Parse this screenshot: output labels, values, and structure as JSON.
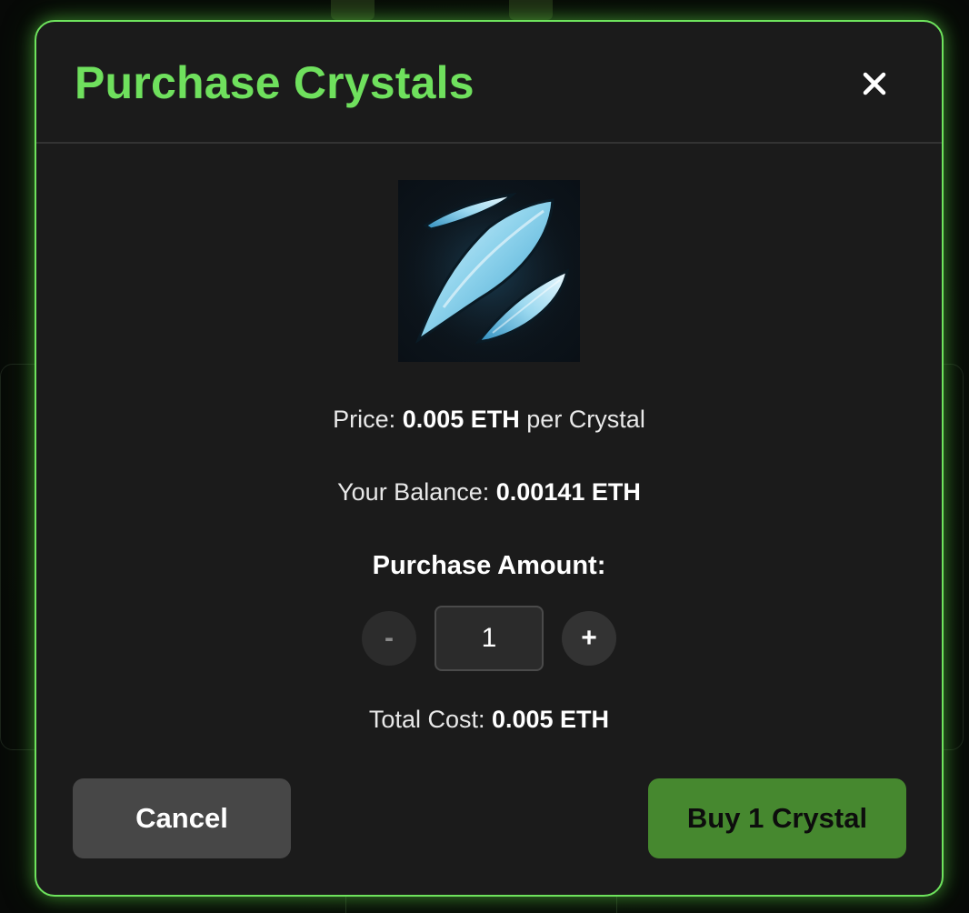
{
  "modal": {
    "title": "Purchase Crystals",
    "close_icon": "close-icon",
    "image_name": "crystal-shards-image"
  },
  "price": {
    "label": "Price: ",
    "value": "0.005 ETH",
    "suffix": " per Crystal"
  },
  "balance": {
    "label": "Your Balance: ",
    "value": "0.00141 ETH"
  },
  "amount": {
    "label": "Purchase Amount:",
    "minus": "-",
    "plus": "+",
    "quantity": "1"
  },
  "total": {
    "label": "Total Cost: ",
    "value": "0.005 ETH"
  },
  "buttons": {
    "cancel": "Cancel",
    "buy": "Buy 1 Crystal"
  },
  "colors": {
    "accent": "#6ee35d",
    "buy_button": "#46882f",
    "cancel_button": "#474747",
    "modal_bg": "#1b1b1b"
  }
}
